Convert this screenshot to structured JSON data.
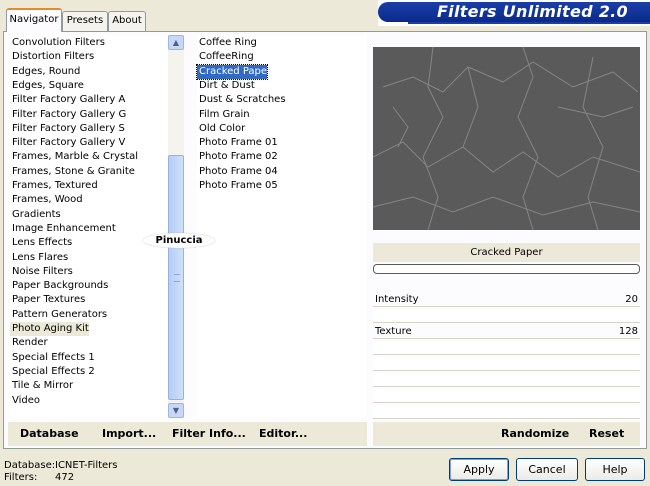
{
  "tabs": [
    {
      "label": "Navigator",
      "active": true
    },
    {
      "label": "Presets",
      "active": false
    },
    {
      "label": "About",
      "active": false
    }
  ],
  "app_title": "Filters Unlimited 2.0",
  "categories": [
    "Convolution Filters",
    "Distortion Filters",
    "Edges, Round",
    "Edges, Square",
    "Filter Factory Gallery A",
    "Filter Factory Gallery G",
    "Filter Factory Gallery S",
    "Filter Factory Gallery V",
    "Frames, Marble & Crystal",
    "Frames, Stone & Granite",
    "Frames, Textured",
    "Frames, Wood",
    "Gradients",
    "Image Enhancement",
    "Lens Effects",
    "Lens Flares",
    "Noise Filters",
    "Paper Backgrounds",
    "Paper Textures",
    "Pattern Generators",
    "Photo Aging Kit",
    "Render",
    "Special Effects 1",
    "Special Effects 2",
    "Tile & Mirror",
    "Video"
  ],
  "selected_category": "Photo Aging Kit",
  "filters": [
    "Coffee Ring",
    "CoffeeRing",
    "Cracked Paper",
    "Dirt & Dust",
    "Dust & Scratches",
    "Film Grain",
    "Old Color",
    "Photo Frame 01",
    "Photo Frame 02",
    "Photo Frame 04",
    "Photo Frame 05"
  ],
  "selected_filter": "Cracked Paper",
  "preview": {
    "filter_name": "Cracked Paper",
    "background": "#5a5a5a"
  },
  "params": [
    {
      "label": "Intensity",
      "value": "20"
    },
    {
      "label": "Texture",
      "value": "128"
    }
  ],
  "toolbar": {
    "database": "Database",
    "import": "Import...",
    "filter_info": "Filter Info...",
    "editor": "Editor...",
    "randomize": "Randomize",
    "reset": "Reset"
  },
  "status": {
    "database_label": "Database:",
    "database_value": "ICNET-Filters",
    "filters_label": "Filters:",
    "filters_value": "472"
  },
  "buttons": {
    "apply": "Apply",
    "cancel": "Cancel",
    "help": "Help"
  },
  "watermark": "Pinuccia",
  "colors": {
    "accent": "#1a3fa8",
    "selection": "#316ac5",
    "tab_highlight": "#e68b2c"
  }
}
